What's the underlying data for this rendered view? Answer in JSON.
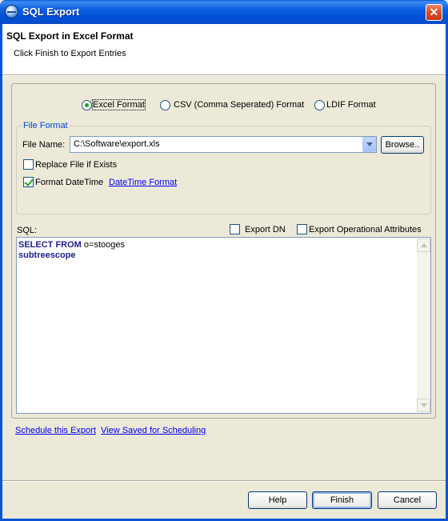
{
  "window": {
    "title": "SQL Export",
    "close": "✕"
  },
  "header": {
    "title": "SQL Export in Excel Format",
    "subtitle": "Click Finish to Export Entries"
  },
  "format_options": [
    {
      "label": "Excel Format",
      "selected": true
    },
    {
      "label": "CSV (Comma Seperated) Format",
      "selected": false
    },
    {
      "label": "LDIF Format",
      "selected": false
    }
  ],
  "file_format": {
    "legend": "File Format",
    "file_name_label": "File Name:",
    "file_name_value": "C:\\Software\\export.xls",
    "browse_label": "Browse..",
    "replace_label": "Replace File if Exists",
    "replace_checked": false,
    "format_datetime_label": "Format DateTime",
    "format_datetime_checked": true,
    "datetime_link": "DateTime Format"
  },
  "sql": {
    "label": "SQL:",
    "export_dn_label": "Export DN",
    "export_dn_checked": false,
    "export_op_label": "Export Operational Attributes",
    "export_op_checked": false,
    "line1_keyword": "SELECT FROM",
    "line1_rest": " o=stooges",
    "line2_keyword": "subtreescope"
  },
  "links": {
    "schedule": "Schedule this Export",
    "view_saved": "View Saved for Scheduling"
  },
  "buttons": {
    "help": "Help",
    "finish": "Finish",
    "cancel": "Cancel"
  },
  "colors": {
    "titlebar": "#0b5fe0",
    "link": "#0000ee",
    "group_legend": "#0046d5",
    "check": "#21a121"
  }
}
